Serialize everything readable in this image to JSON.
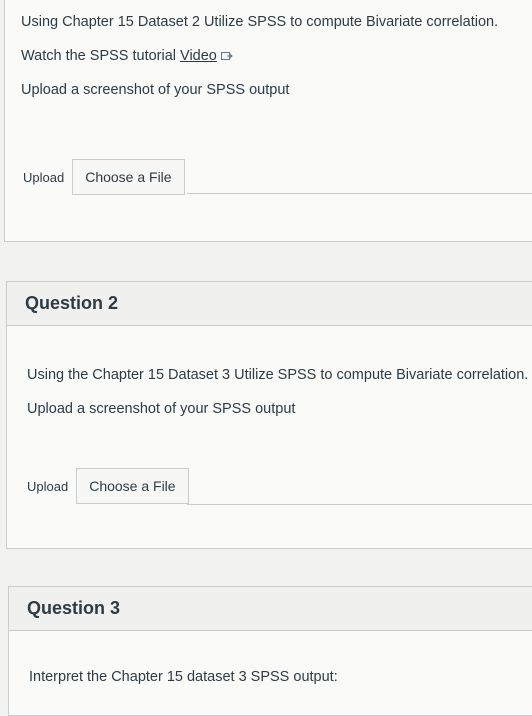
{
  "question1": {
    "lines": [
      "Using Chapter 15 Dataset 2 Utilize SPSS to compute Bivariate correlation.",
      "Watch the SPSS tutorial ",
      "Upload a screenshot of your SPSS output"
    ],
    "video_link": "Video",
    "upload_label": "Upload",
    "file_button": "Choose a File"
  },
  "question2": {
    "title": "Question 2",
    "lines": [
      "Using the Chapter 15 Dataset 3 Utilize  SPSS to compute Bivariate correlation.",
      "Upload a screenshot of your SPSS output"
    ],
    "upload_label": "Upload",
    "file_button": "Choose a File"
  },
  "question3": {
    "title": "Question 3",
    "line": "Interpret the Chapter 15 dataset 3 SPSS output:"
  }
}
